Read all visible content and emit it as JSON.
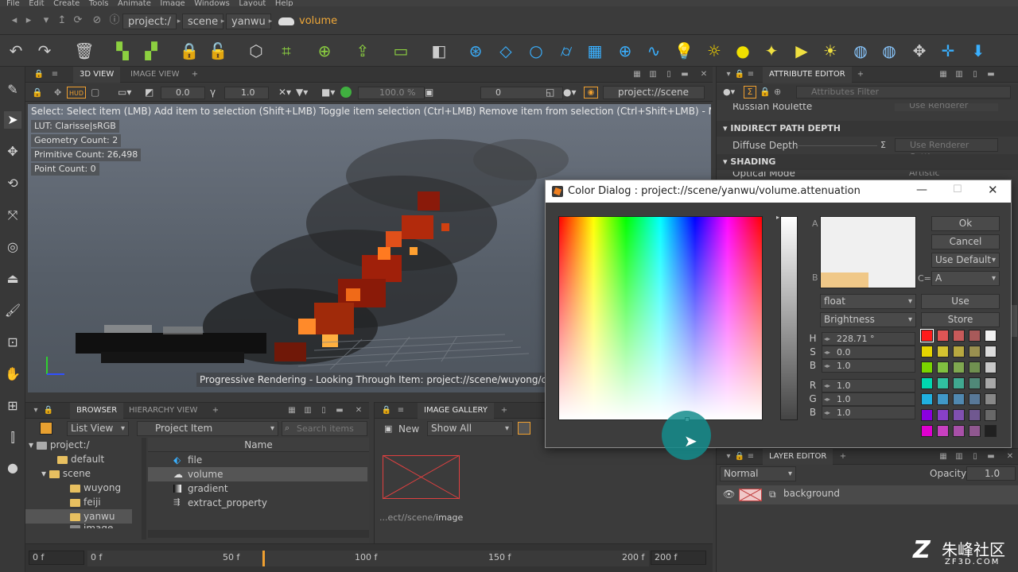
{
  "menu": [
    "File",
    "Edit",
    "Create",
    "Tools",
    "Animate",
    "Image",
    "Windows",
    "Layout",
    "Help"
  ],
  "breadcrumb": [
    "project:/",
    "scene",
    "yanwu"
  ],
  "breadcrumb_active": "volume",
  "viewport_panel": {
    "tabs": [
      "3D VIEW",
      "IMAGE VIEW"
    ],
    "hud": "HUD",
    "field_a": "0.0",
    "field_b": "1.0",
    "zoom": "100.0 %",
    "frame": "0",
    "path": "project://scene",
    "help_text": "Select: Select item (LMB)  Add item to selection (Shift+LMB)  Toggle item selection (Ctrl+LMB)  Remove item from selection (Ctrl+Shift+LMB) - Mode: Auto(Z Ne",
    "stats": [
      "LUT: Clarisse|sRGB",
      "Geometry Count: 2",
      "Primitive Count: 26,498",
      "Point Count: 0"
    ],
    "status": "Progressive Rendering - Looking Through Item: project://scene/wuyong/camera"
  },
  "browser": {
    "tabs": [
      "BROWSER",
      "HIERARCHY VIEW"
    ],
    "view_mode": "List View",
    "item_type": "Project Item",
    "search_placeholder": "Search items",
    "column_name": "Name",
    "tree": [
      "project:/",
      "default",
      "scene",
      "wuyong",
      "feiji",
      "yanwu",
      "image"
    ],
    "items": [
      "file",
      "volume",
      "gradient",
      "extract_property"
    ]
  },
  "gallery": {
    "tab": "IMAGE GALLERY",
    "new_label": "New",
    "filter": "Show All",
    "thumb_path": "...ect//scene/",
    "thumb_name": "image"
  },
  "timeline": {
    "start": "0 f",
    "end": "200 f",
    "ticks": [
      "0 f",
      "50 f",
      "100 f",
      "150 f",
      "200 f"
    ]
  },
  "attribute_editor": {
    "tab": "ATTRIBUTE EDITOR",
    "filter_placeholder": "Attributes Filter",
    "rows": [
      {
        "label": "Russian Roulette",
        "value": "Use Renderer Settings"
      },
      {
        "label": "Diffuse Depth",
        "value": "Use Renderer Settings"
      },
      {
        "label": "Optical Mode",
        "value": "Artistic"
      }
    ],
    "sections": [
      "INDIRECT PATH DEPTH",
      "SHADING"
    ]
  },
  "layer_editor": {
    "tab": "LAYER EDITOR",
    "blend": "Normal",
    "opacity_label": "Opacity",
    "opacity": "1.0",
    "layer_name": "background"
  },
  "color_dialog": {
    "title": "Color Dialog : project://scene/yanwu/volume.attenuation",
    "label_a": "A",
    "label_b": "B",
    "ok": "Ok",
    "cancel": "Cancel",
    "use_default": "Use Default",
    "c_label": "C=",
    "c_value": "A",
    "type": "float",
    "mode": "Brightness",
    "use": "Use",
    "store": "Store",
    "hsb": [
      {
        "label": "H",
        "value": "228.71 °"
      },
      {
        "label": "S",
        "value": "0.0"
      },
      {
        "label": "B",
        "value": "1.0"
      }
    ],
    "rgb": [
      {
        "label": "R",
        "value": "1.0"
      },
      {
        "label": "G",
        "value": "1.0"
      },
      {
        "label": "B",
        "value": "1.0"
      }
    ],
    "swatches": [
      [
        "#ff1a1a",
        "#e05555",
        "#c85a5a",
        "#a85a5a",
        "#f2f2f2"
      ],
      [
        "#e6d400",
        "#d4c230",
        "#b8a840",
        "#9a9050",
        "#dcdcdc"
      ],
      [
        "#7ad400",
        "#80c040",
        "#80a850",
        "#709050",
        "#c8c8c8"
      ],
      [
        "#00d8b0",
        "#30c0a0",
        "#40a890",
        "#508878",
        "#a8a8a8"
      ],
      [
        "#20b0e0",
        "#4098c8",
        "#5088b0",
        "#587898",
        "#888888"
      ],
      [
        "#8a00e0",
        "#8840c8",
        "#8050b0",
        "#705890",
        "#686868"
      ],
      [
        "#e000d0",
        "#c840c0",
        "#a850a8",
        "#905890",
        "#202020"
      ]
    ]
  },
  "watermark": {
    "brand": "朱峰社区",
    "domain": "ZF3D.COM"
  }
}
